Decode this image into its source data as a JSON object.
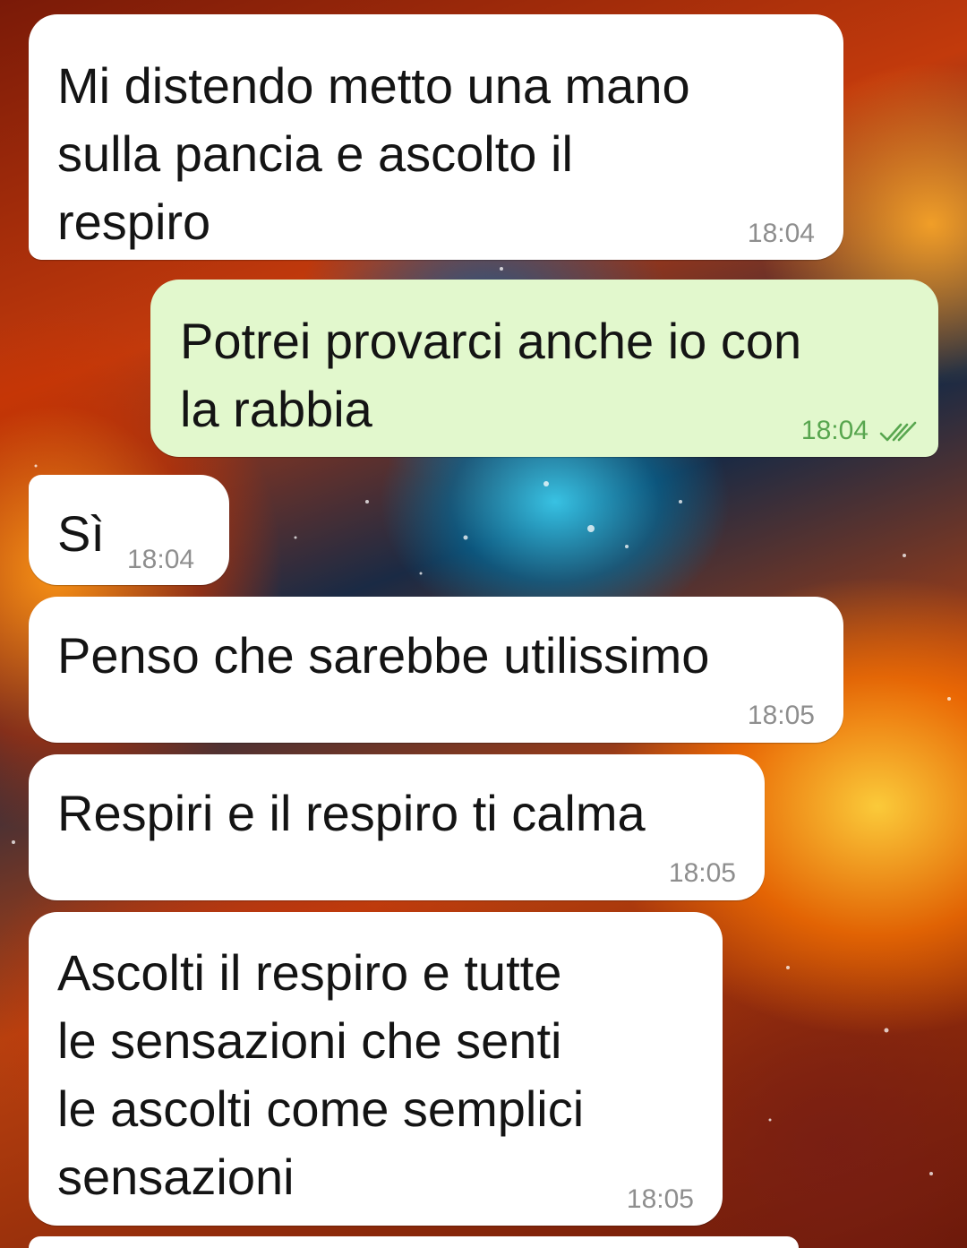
{
  "wallpaper": {
    "name": "galaxy-fire-wallpaper",
    "colors": {
      "fire": "#c23a0c",
      "nebula": "#3cdcff",
      "deep": "#1a2a44"
    }
  },
  "theme": {
    "incoming_bubble": "#ffffff",
    "outgoing_bubble": "#e2f8cd",
    "text": "#141414",
    "time_incoming": "#8e8e8e",
    "time_outgoing": "#58a64f"
  },
  "messages": [
    {
      "direction": "incoming",
      "text": "Mi distendo metto una mano\nsulla pancia e ascolto il\nrespiro",
      "time": "18:04"
    },
    {
      "direction": "outgoing",
      "text": "Potrei provarci anche io con\nla rabbia",
      "time": "18:04",
      "status_icon": "double-check-read-icon"
    },
    {
      "direction": "incoming",
      "text": "Sì",
      "time": "18:04"
    },
    {
      "direction": "incoming",
      "text": "Penso che sarebbe utilissimo",
      "time": "18:05"
    },
    {
      "direction": "incoming",
      "text": "Respiri e il respiro ti calma",
      "time": "18:05"
    },
    {
      "direction": "incoming",
      "text": "Ascolti il respiro e tutte\nle sensazioni che senti\nle ascolti come semplici\nsensazioni",
      "time": "18:05"
    }
  ]
}
